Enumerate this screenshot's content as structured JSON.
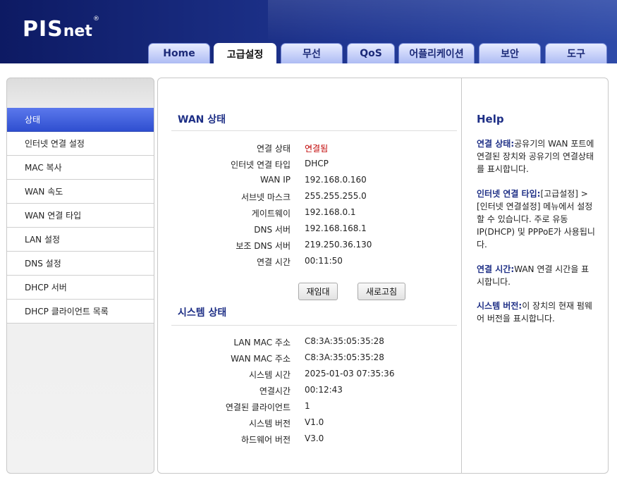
{
  "brand": {
    "logo_main": "PIS",
    "logo_sub": "net",
    "registered": "®"
  },
  "tabs": [
    {
      "label": "Home"
    },
    {
      "label": "고급설정"
    },
    {
      "label": "무선"
    },
    {
      "label": "QoS"
    },
    {
      "label": "어플리케이션"
    },
    {
      "label": "보안"
    },
    {
      "label": "도구"
    }
  ],
  "active_tab": "고급설정",
  "sidebar": {
    "items": [
      {
        "label": "상태"
      },
      {
        "label": "인터넷 연결 설정"
      },
      {
        "label": "MAC 복사"
      },
      {
        "label": "WAN 속도"
      },
      {
        "label": "WAN 연결 타입"
      },
      {
        "label": "LAN 설정"
      },
      {
        "label": "DNS 설정"
      },
      {
        "label": "DHCP 서버"
      },
      {
        "label": "DHCP 클라이언트 목록"
      }
    ],
    "active": "상태"
  },
  "wan": {
    "title": "WAN 상태",
    "rows": [
      {
        "label": "연결 상태",
        "value": "연결됨"
      },
      {
        "label": "인터넷 연결 타입",
        "value": "DHCP"
      },
      {
        "label": "WAN IP",
        "value": "192.168.0.160"
      },
      {
        "label": "서브넷 마스크",
        "value": "255.255.255.0"
      },
      {
        "label": "게이트웨이",
        "value": "192.168.0.1"
      },
      {
        "label": "DNS 서버",
        "value": "192.168.168.1"
      },
      {
        "label": "보조 DNS 서버",
        "value": "219.250.36.130"
      },
      {
        "label": "연결 시간",
        "value": "00:11:50"
      }
    ],
    "status_color": "#c00000",
    "buttons": {
      "reassign": "재임대",
      "refresh": "새로고침"
    }
  },
  "system": {
    "title": "시스템 상태",
    "rows": [
      {
        "label": "LAN MAC 주소",
        "value": "C8:3A:35:05:35:28"
      },
      {
        "label": "WAN MAC 주소",
        "value": "C8:3A:35:05:35:28"
      },
      {
        "label": "시스템 시간",
        "value": "2025-01-03 07:35:36"
      },
      {
        "label": "연결시간",
        "value": "00:12:43"
      },
      {
        "label": "연결된 클라이언트",
        "value": "1"
      },
      {
        "label": "시스템 버전",
        "value": "V1.0"
      },
      {
        "label": "하드웨어 버전",
        "value": "V3.0"
      }
    ]
  },
  "help": {
    "title": "Help",
    "items": [
      {
        "term": "연결 상태:",
        "text": "공유기의 WAN 포트에 연결된 장치와 공유기의 연결상태를 표시합니다."
      },
      {
        "term": "인터넷 연결 타입:",
        "text": "[고급설정] > [인터넷 연결설정] 메뉴에서 설정할 수 있습니다. 주로 유동IP(DHCP) 및 PPPoE가 사용됩니다."
      },
      {
        "term": "연결 시간:",
        "text": "WAN 연결 시간을 표시합니다."
      },
      {
        "term": "시스템 버전:",
        "text": "이 장치의 현재 펌웨어 버전을 표시합니다."
      }
    ]
  }
}
